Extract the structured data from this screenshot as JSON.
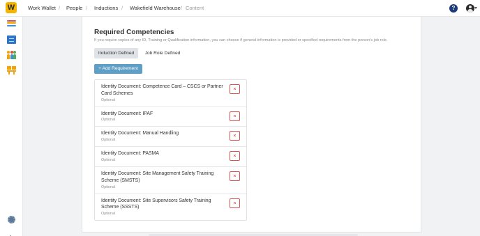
{
  "header": {
    "logo_letter": "W",
    "breadcrumbs": [
      "Work Wallet",
      "People",
      "Inductions",
      "Wakefield Warehouse"
    ],
    "current": "Content",
    "separator": "/",
    "help_label": "?"
  },
  "sidebar": {
    "items": [
      "list-icon",
      "building-icon",
      "people-icon",
      "boxes-icon"
    ],
    "settings_icon": "gear-icon",
    "expand_glyph": "›"
  },
  "competencies": {
    "title": "Required Competencies",
    "description": "If you require copies of any ID, Training or Qualification information, you can choose if general information is provided or specified requirements from the person's job role.",
    "tabs": [
      "Induction Defined",
      "Job Role Defined"
    ],
    "active_tab": "Induction Defined",
    "add_button": "+ Add Requirement",
    "remove_glyph": "×",
    "items": [
      {
        "title": "Identity Document: Competence Card – CSCS or Partner Card Schemes",
        "status": "Optional"
      },
      {
        "title": "Identity Document: IPAF",
        "status": "Optional"
      },
      {
        "title": "Identity Document: Manual Handling",
        "status": "Optional"
      },
      {
        "title": "Identity Document: PASMA",
        "status": "Optional"
      },
      {
        "title": "Identity Document: Site Management Safety Training Scheme (SMSTS)",
        "status": "Optional"
      },
      {
        "title": "Identity Document: Site Supervisors Safety Training Scheme (SSSTS)",
        "status": "Optional"
      }
    ]
  },
  "colors": {
    "accent": "#5f9fc5",
    "danger": "#d9534f",
    "logo": "#f4b400",
    "help": "#1d3b78"
  }
}
